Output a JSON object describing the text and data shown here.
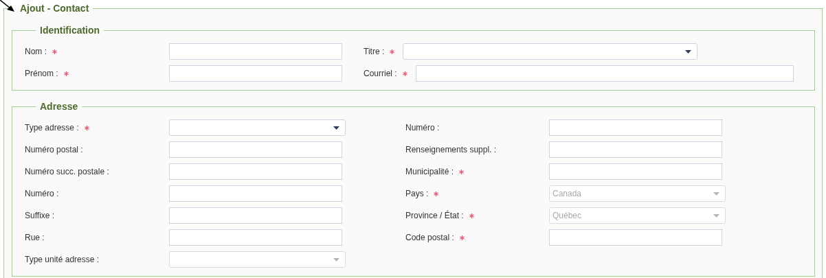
{
  "title": "Ajout - Contact",
  "sections": [
    {
      "title": "Identification",
      "columns": [
        [
          {
            "label": "Nom :",
            "required": true,
            "kind": "text",
            "disabled": false
          },
          {
            "label": "Prénom :",
            "required": true,
            "kind": "text",
            "disabled": false
          }
        ],
        [
          {
            "label": "Titre :",
            "required": true,
            "kind": "select",
            "disabled": false
          },
          {
            "label": "Courriel :",
            "required": true,
            "kind": "text",
            "disabled": false
          }
        ]
      ]
    },
    {
      "title": "Adresse",
      "columns": [
        [
          {
            "label": "Type adresse :",
            "required": true,
            "kind": "select",
            "disabled": false
          },
          {
            "label": "Numéro postal :",
            "required": false,
            "kind": "text",
            "disabled": false
          },
          {
            "label": "Numéro succ. postale :",
            "required": false,
            "kind": "text",
            "disabled": false
          },
          {
            "label": "Numéro :",
            "required": false,
            "kind": "text",
            "disabled": false
          },
          {
            "label": "Suffixe :",
            "required": false,
            "kind": "text",
            "disabled": false
          },
          {
            "label": "Rue :",
            "required": false,
            "kind": "text",
            "disabled": false
          },
          {
            "label": "Type unité adresse :",
            "required": false,
            "kind": "select",
            "disabled": true
          }
        ],
        [
          {
            "label": "Numéro :",
            "required": false,
            "kind": "text",
            "disabled": false
          },
          {
            "label": "Renseignements suppl. :",
            "required": false,
            "kind": "text",
            "disabled": false
          },
          {
            "label": "Municipalité :",
            "required": true,
            "kind": "text",
            "disabled": false
          },
          {
            "label": "Pays :",
            "required": true,
            "kind": "select",
            "disabled": true,
            "value": "Canada"
          },
          {
            "label": "Province / État :",
            "required": true,
            "kind": "select",
            "disabled": true,
            "value": "Québec"
          },
          {
            "label": "Code postal :",
            "required": true,
            "kind": "text",
            "disabled": false
          }
        ]
      ]
    }
  ]
}
